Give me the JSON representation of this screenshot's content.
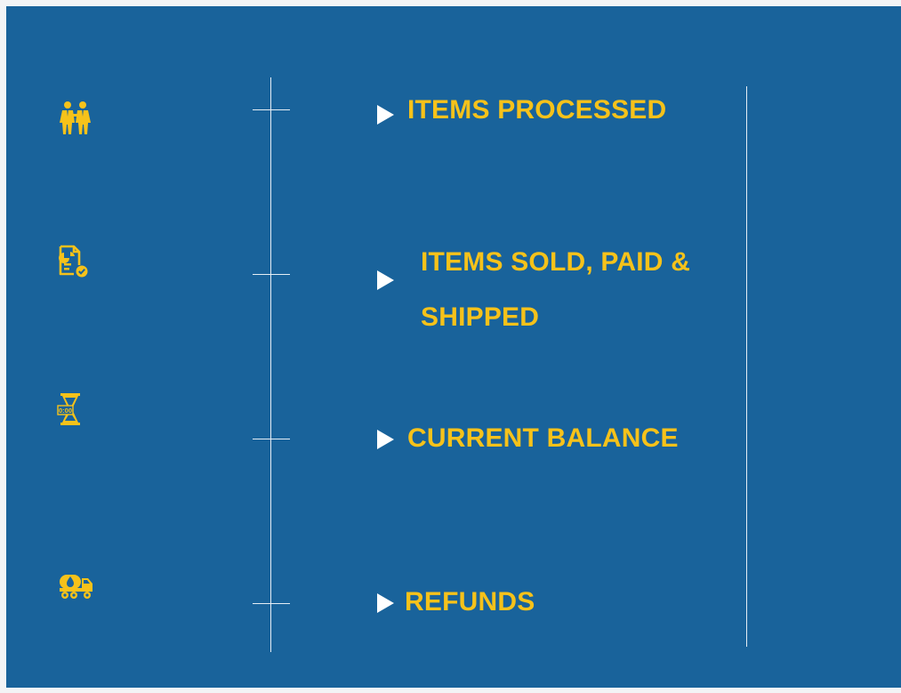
{
  "colors": {
    "panel_background": "#19639b",
    "accent_yellow": "#f6c21a",
    "line_white": "#e6eef5",
    "arrow_white": "#ffffff"
  },
  "items": [
    {
      "icon": "business-partners-icon",
      "label": "ITEMS PROCESSED"
    },
    {
      "icon": "document-chart-check-icon",
      "label": "ITEMS SOLD, PAID & SHIPPED"
    },
    {
      "icon": "hourglass-timer-icon",
      "icon_text": "0:00",
      "label": "CURRENT BALANCE"
    },
    {
      "icon": "tanker-truck-icon",
      "label": "REFUNDS"
    }
  ]
}
